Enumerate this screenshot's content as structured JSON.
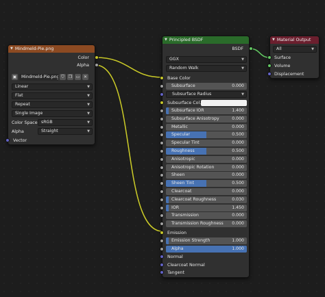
{
  "image_node": {
    "title": "Mindmeld-Pie.png",
    "header_color": "#8c4a22",
    "outputs": [
      "Color",
      "Alpha"
    ],
    "image_name": "Mindmeld-Pie.png",
    "interpolation": "Linear",
    "projection": "Flat",
    "extension": "Repeat",
    "source": "Single Image",
    "color_space_label": "Color Space",
    "color_space": "sRGB",
    "alpha_label": "Alpha",
    "alpha_mode": "Straight",
    "vector_label": "Vector"
  },
  "bsdf_node": {
    "title": "Principled BSDF",
    "header_color": "#2a6b2a",
    "output": "BSDF",
    "distribution": "GGX",
    "subsurface_method": "Random Walk",
    "base_color": "Base Color",
    "subsurface_radius": "Subsurface Radius",
    "subsurface_color": "Subsurface Col...",
    "emission": "Emission",
    "normal": "Normal",
    "clearcoat_normal": "Clearcoat Normal",
    "tangent": "Tangent",
    "sliders_a": [
      {
        "label": "Subsurface",
        "value": "0.000",
        "fill": 0
      }
    ],
    "sliders_b": [
      {
        "label": "Subsurface IOR",
        "value": "1.400",
        "fill": 0.03
      },
      {
        "label": "Subsurface Anisotropy",
        "value": "0.000",
        "fill": 0
      },
      {
        "label": "Metallic",
        "value": "0.000",
        "fill": 0
      },
      {
        "label": "Specular",
        "value": "0.500",
        "fill": 0.5
      },
      {
        "label": "Specular Tint",
        "value": "0.000",
        "fill": 0
      },
      {
        "label": "Roughness",
        "value": "0.500",
        "fill": 0.5
      },
      {
        "label": "Anisotropic",
        "value": "0.000",
        "fill": 0
      },
      {
        "label": "Anisotropic Rotation",
        "value": "0.000",
        "fill": 0
      },
      {
        "label": "Sheen",
        "value": "0.000",
        "fill": 0
      },
      {
        "label": "Sheen Tint",
        "value": "0.500",
        "fill": 0.5
      },
      {
        "label": "Clearcoat",
        "value": "0.000",
        "fill": 0
      },
      {
        "label": "Clearcoat Roughness",
        "value": "0.030",
        "fill": 0.03
      },
      {
        "label": "IOR",
        "value": "1.450",
        "fill": 0.03
      },
      {
        "label": "Transmission",
        "value": "0.000",
        "fill": 0
      },
      {
        "label": "Transmission Roughness",
        "value": "0.000",
        "fill": 0
      }
    ],
    "sliders_c": [
      {
        "label": "Emission Strength",
        "value": "1.000",
        "fill": 0.03
      },
      {
        "label": "Alpha",
        "value": "1.000",
        "fill": 1
      }
    ]
  },
  "output_node": {
    "title": "Material Output",
    "header_color": "#6b1f2e",
    "target": "All",
    "inputs": [
      "Surface",
      "Volume",
      "Displacement"
    ]
  },
  "colors": {
    "wire_color": "#c7c729",
    "wire_shader": "#63c763",
    "slider_fill": "#4772b3"
  }
}
